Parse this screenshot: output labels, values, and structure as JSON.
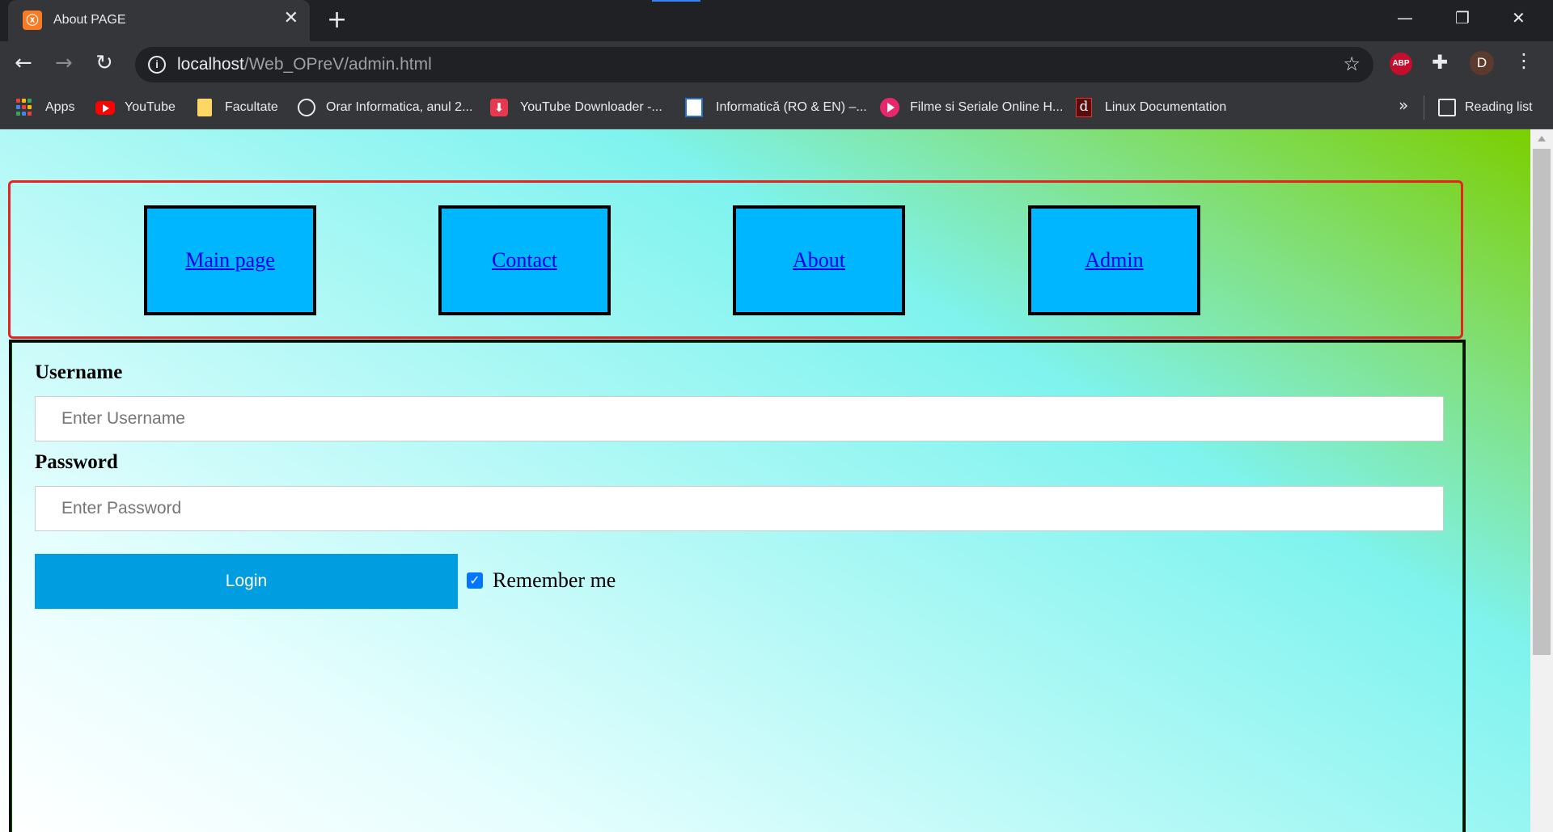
{
  "browser": {
    "tab_title": "About PAGE",
    "tab_close": "✕",
    "new_tab": "+",
    "window": {
      "minimize": "—",
      "restore": "❐",
      "close": "✕"
    },
    "nav": {
      "back": "←",
      "forward": "→",
      "reload": "↻"
    },
    "url": {
      "host": "localhost",
      "path": "/Web_OPreV/admin.html"
    },
    "info_icon": "i",
    "star_icon": "☆",
    "extensions": {
      "abp": "ABP",
      "puzzle": "✚",
      "profile": "D",
      "menu": "⋮"
    },
    "bookmarks": [
      {
        "label": "Apps",
        "icon": "apps-icon"
      },
      {
        "label": "YouTube",
        "icon": "youtube-icon"
      },
      {
        "label": "Facultate",
        "icon": "folder-icon"
      },
      {
        "label": "Orar Informatica, anul 2...",
        "icon": "globe-icon"
      },
      {
        "label": "YouTube Downloader -...",
        "icon": "download-icon"
      },
      {
        "label": "Informatică (RO & EN) –...",
        "icon": "university-icon"
      },
      {
        "label": "Filme si Seriale Online H...",
        "icon": "play-icon"
      },
      {
        "label": "Linux Documentation",
        "icon": "linux-doc-icon"
      }
    ],
    "more_bookmarks": "»",
    "reading_list": "Reading list",
    "download_glyph": "⬇",
    "linux_glyph": "d"
  },
  "nav_links": [
    {
      "label": "Main page"
    },
    {
      "label": "Contact"
    },
    {
      "label": "About"
    },
    {
      "label": "Admin"
    }
  ],
  "form": {
    "username_label": "Username",
    "username_placeholder": "Enter Username",
    "password_label": "Password",
    "password_placeholder": "Enter Password",
    "login_label": "Login",
    "remember_label": "Remember me",
    "remember_checked": true,
    "check_glyph": "✓"
  },
  "colors": {
    "nav_border": "#e8221e",
    "nav_button_bg": "#00b7ff",
    "login_button_bg": "#009ee0",
    "gradient_top_right": "#7ccf00",
    "gradient_cyan": "#7ff3ee"
  }
}
